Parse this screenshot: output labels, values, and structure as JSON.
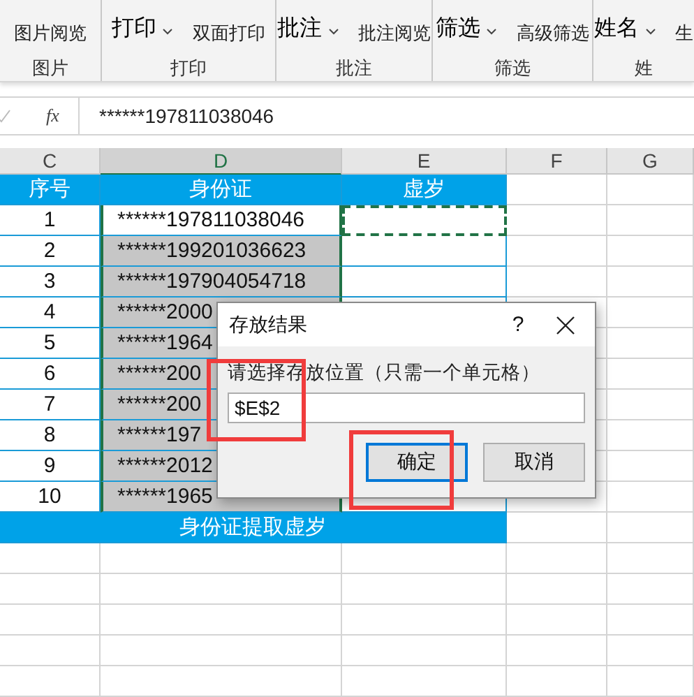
{
  "ribbon": {
    "groups": [
      {
        "label": "图片",
        "small": "图片阅览"
      },
      {
        "label": "打印",
        "big": "打印",
        "small": "双面打印"
      },
      {
        "label": "批注",
        "big": "批注",
        "small": "批注阅览"
      },
      {
        "label": "筛选",
        "big": "筛选",
        "small": "高级筛选"
      },
      {
        "label": "姓",
        "big": "姓名",
        "small": "生"
      }
    ]
  },
  "formula_bar": {
    "fx": "fx",
    "value": "******197811038046"
  },
  "columns": [
    {
      "label": "C",
      "selected": false
    },
    {
      "label": "D",
      "selected": true
    },
    {
      "label": "E",
      "selected": false
    },
    {
      "label": "F",
      "selected": false
    },
    {
      "label": "G",
      "selected": false
    }
  ],
  "header_row": [
    "序号",
    "身份证",
    "虚岁"
  ],
  "copy_marquee": true,
  "rows": [
    {
      "no": "1",
      "id": "******197811038046",
      "selected": false
    },
    {
      "no": "2",
      "id": "******199201036623",
      "selected": true
    },
    {
      "no": "3",
      "id": "******197904054718",
      "selected": true
    },
    {
      "no": "4",
      "id": "******2000",
      "selected": true
    },
    {
      "no": "5",
      "id": "******1964",
      "selected": true
    },
    {
      "no": "6",
      "id": "******200",
      "selected": true
    },
    {
      "no": "7",
      "id": "******200",
      "selected": true
    },
    {
      "no": "8",
      "id": "******197",
      "selected": true
    },
    {
      "no": "9",
      "id": "******2012",
      "selected": true
    },
    {
      "no": "10",
      "id": "******1965",
      "selected": true
    }
  ],
  "footer_row": "身份证提取虚岁",
  "dialog": {
    "title": "存放结果",
    "help": "?",
    "prompt": "请选择存放位置（只需一个单元格）",
    "value": "$E$2",
    "buttons": [
      {
        "label": "确定",
        "default": true
      },
      {
        "label": "取消",
        "default": false
      }
    ]
  }
}
